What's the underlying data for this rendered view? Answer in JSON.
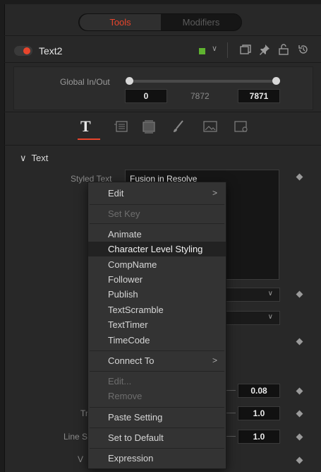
{
  "segment": {
    "tools_label": "Tools",
    "modifiers_label": "Modifiers"
  },
  "node": {
    "name": "Text2",
    "color_swatch": "#5fb330"
  },
  "global_inout": {
    "label": "Global In/Out",
    "in_value": "0",
    "mid_value": "7872",
    "out_value": "7871"
  },
  "section": {
    "title": "Text"
  },
  "styled_text": {
    "label": "Styled Text",
    "value": "Fusion in Resolve"
  },
  "partial_labels": {
    "tr": "Tr",
    "line_s": "Line S",
    "v": "V"
  },
  "values": {
    "v1": "0.08",
    "v2": "1.0",
    "v3": "1.0"
  },
  "context_menu": {
    "edit": "Edit",
    "set_key": "Set Key",
    "animate": "Animate",
    "character_level_styling": "Character Level Styling",
    "compname": "CompName",
    "follower": "Follower",
    "publish": "Publish",
    "textscramble": "TextScramble",
    "texttimer": "TextTimer",
    "timecode": "TimeCode",
    "connect_to": "Connect To",
    "edit_dots": "Edit...",
    "remove": "Remove",
    "paste_setting": "Paste Setting",
    "set_to_default": "Set to Default",
    "expression": "Expression"
  },
  "accent_color": "#e8452c"
}
